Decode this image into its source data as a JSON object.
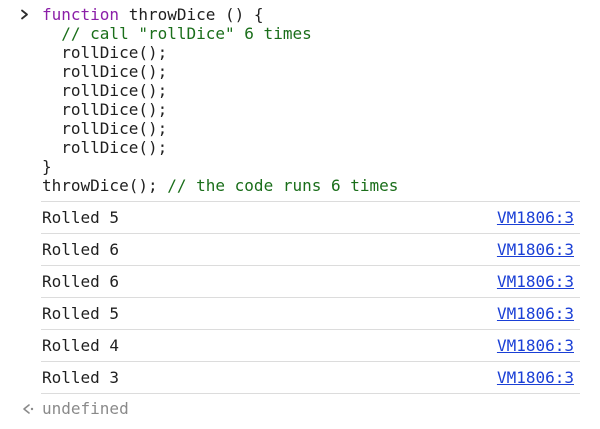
{
  "input": {
    "prompt_icon": "chevron-right-icon",
    "lines": [
      {
        "tokens": [
          {
            "t": "function",
            "c": "kw"
          },
          {
            "t": " throwDice () {",
            "c": "plain"
          }
        ]
      },
      {
        "tokens": [
          {
            "t": "  // call \"rollDice\" 6 times",
            "c": "comment"
          }
        ]
      },
      {
        "tokens": [
          {
            "t": "  rollDice();",
            "c": "plain"
          }
        ]
      },
      {
        "tokens": [
          {
            "t": "  rollDice();",
            "c": "plain"
          }
        ]
      },
      {
        "tokens": [
          {
            "t": "  rollDice();",
            "c": "plain"
          }
        ]
      },
      {
        "tokens": [
          {
            "t": "  rollDice();",
            "c": "plain"
          }
        ]
      },
      {
        "tokens": [
          {
            "t": "  rollDice();",
            "c": "plain"
          }
        ]
      },
      {
        "tokens": [
          {
            "t": "  rollDice();",
            "c": "plain"
          }
        ]
      },
      {
        "tokens": [
          {
            "t": "}",
            "c": "plain"
          }
        ]
      },
      {
        "tokens": [
          {
            "t": "throwDice(); ",
            "c": "plain"
          },
          {
            "t": "// the code runs 6 times",
            "c": "comment"
          }
        ]
      }
    ]
  },
  "logs": [
    {
      "message": "Rolled 5",
      "source": "VM1806:3"
    },
    {
      "message": "Rolled 6",
      "source": "VM1806:3"
    },
    {
      "message": "Rolled 6",
      "source": "VM1806:3"
    },
    {
      "message": "Rolled 5",
      "source": "VM1806:3"
    },
    {
      "message": "Rolled 4",
      "source": "VM1806:3"
    },
    {
      "message": "Rolled 3",
      "source": "VM1806:3"
    }
  ],
  "result": {
    "icon": "return-arrow-icon",
    "value": "undefined"
  },
  "colors": {
    "keyword": "#8b1fa8",
    "comment": "#1a6e1a",
    "link": "#1a3fd6",
    "result": "#8a8a8a",
    "divider": "#dcdcdc"
  }
}
